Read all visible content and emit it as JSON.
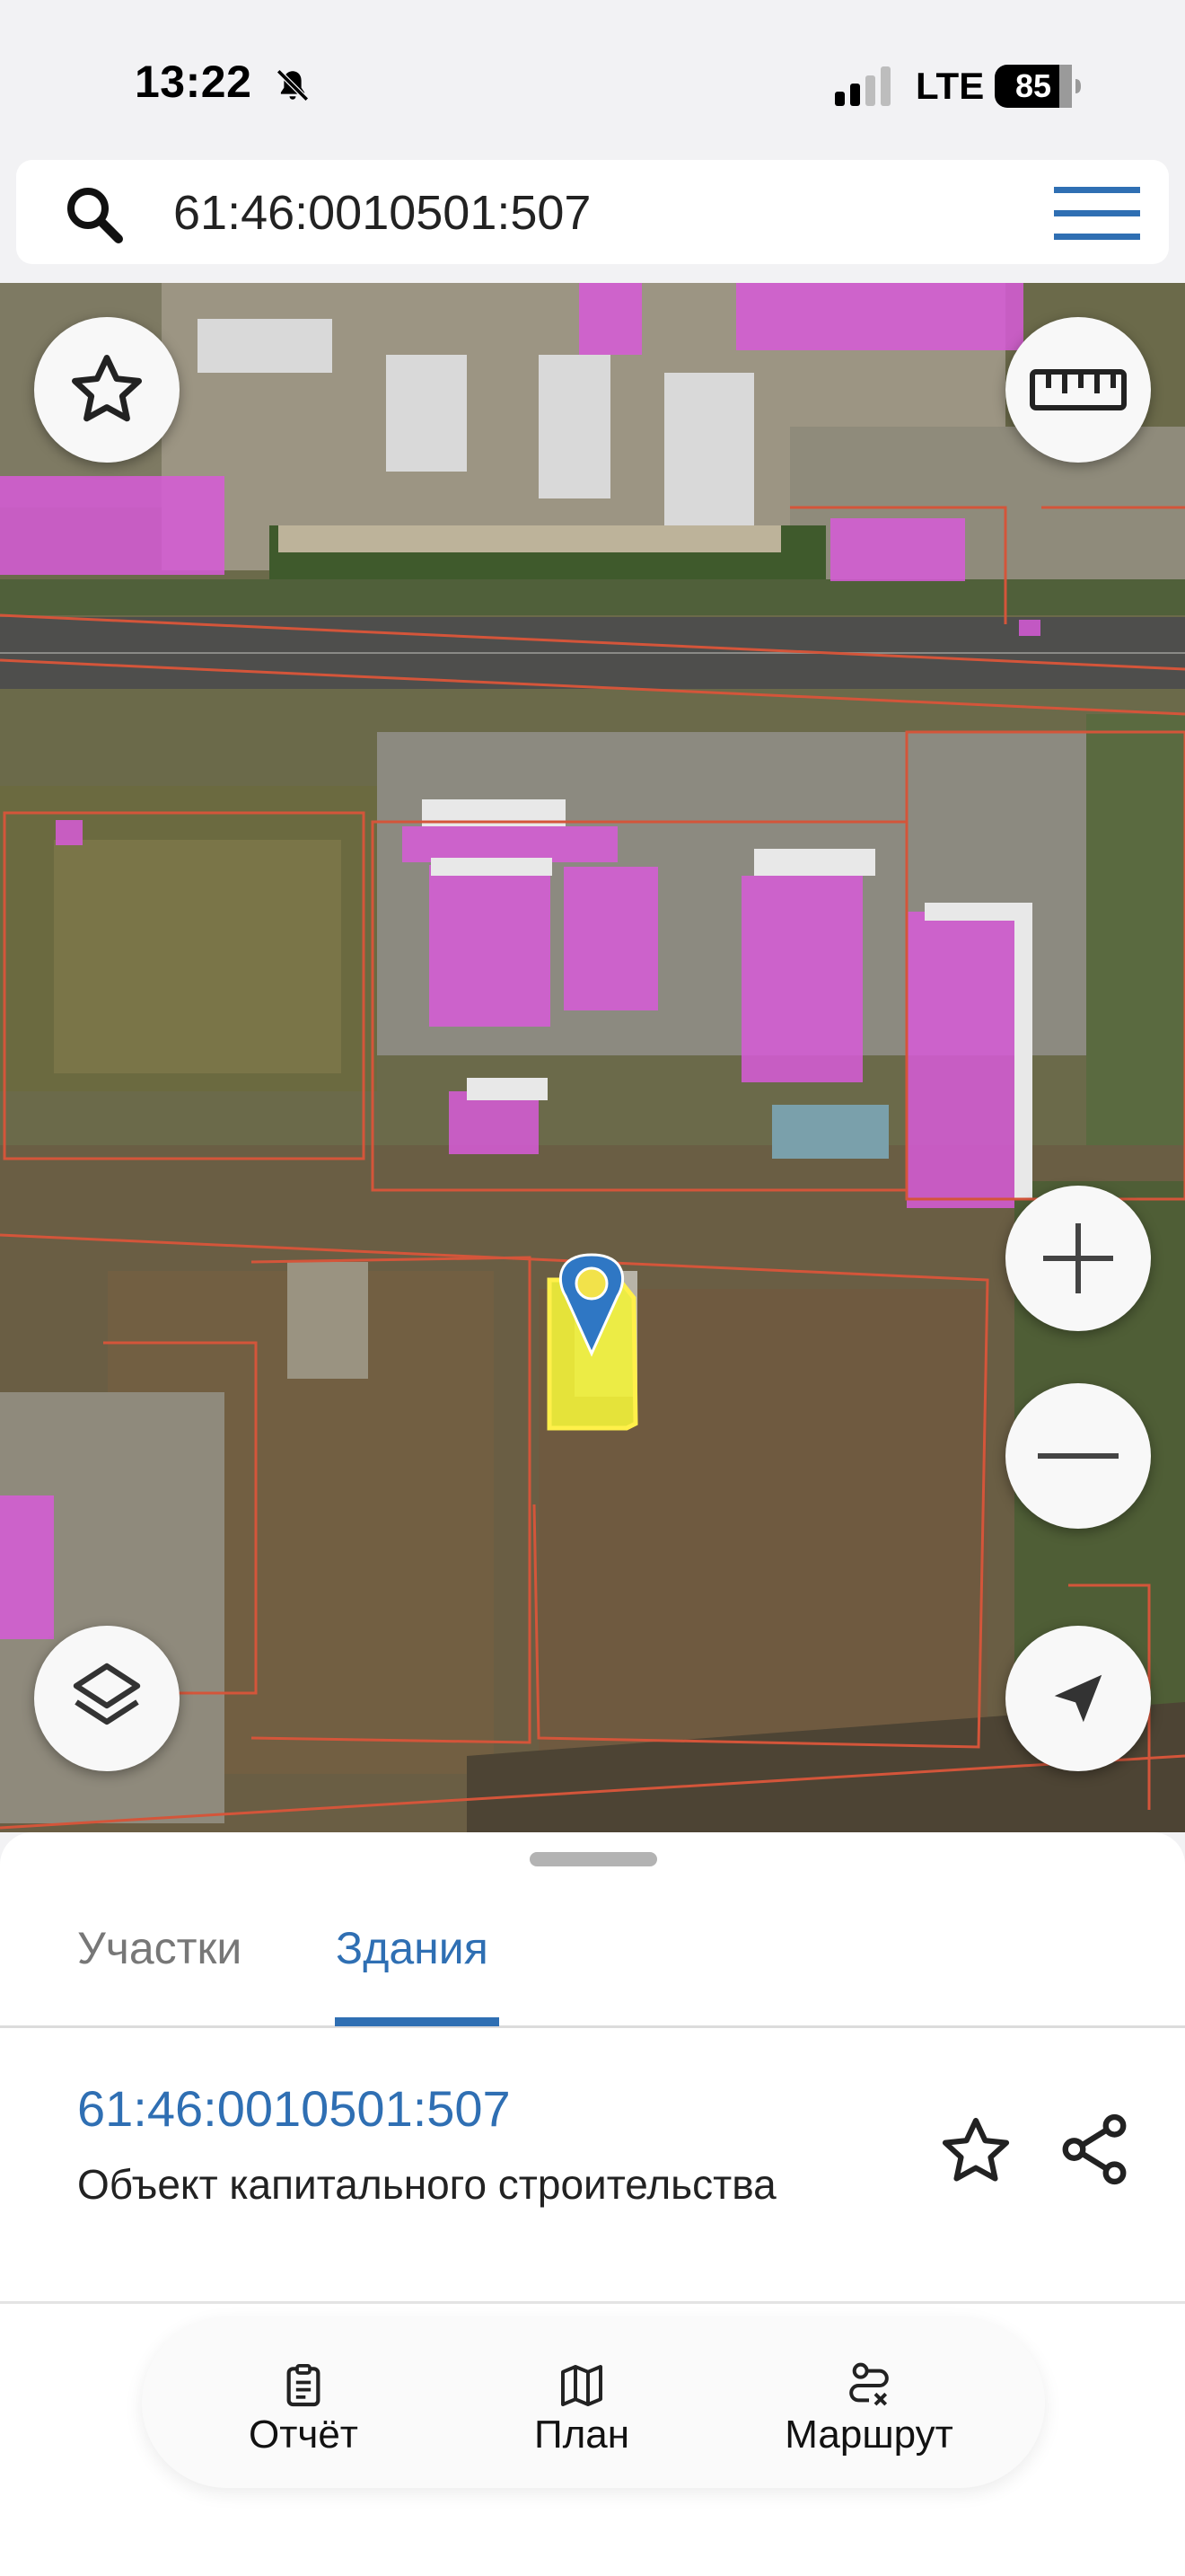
{
  "status_bar": {
    "time": "13:22",
    "network": "LTE",
    "battery": "85"
  },
  "search": {
    "value": "61:46:0010501:507"
  },
  "map": {
    "controls": [
      "favorite",
      "ruler",
      "zoom-in",
      "zoom-out",
      "layers",
      "locate"
    ],
    "colors": {
      "parcel_outline": "#d4553a",
      "building_fill": "#d75ad8",
      "selected_building": "#f2f23a",
      "marker": "#2f77c4"
    }
  },
  "sheet": {
    "tabs": [
      {
        "label": "Участки",
        "active": false
      },
      {
        "label": "Здания",
        "active": true
      }
    ],
    "result": {
      "id": "61:46:0010501:507",
      "type": "Объект капитального строительства"
    },
    "actions": [
      {
        "label": "Отчёт",
        "icon": "clipboard-icon"
      },
      {
        "label": "План",
        "icon": "map-icon"
      },
      {
        "label": "Маршрут",
        "icon": "route-icon"
      }
    ]
  }
}
